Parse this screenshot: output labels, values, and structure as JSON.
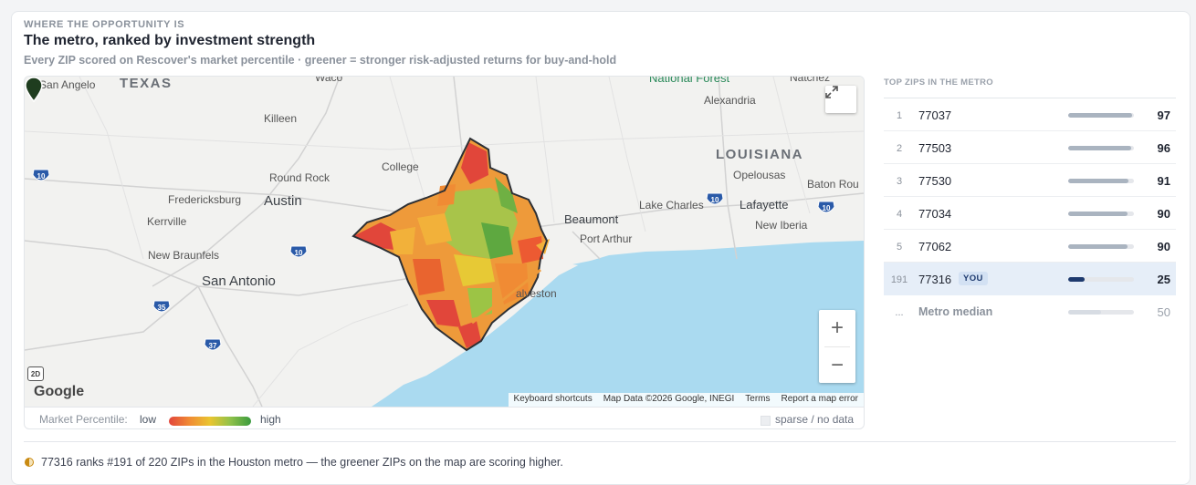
{
  "header": {
    "eyebrow": "WHERE THE OPPORTUNITY IS",
    "title": "The metro, ranked by investment strength",
    "subtitle": "Every ZIP scored on Rescover's market percentile · greener = stronger risk-adjusted returns for buy-and-hold"
  },
  "map": {
    "labels": {
      "san_angelo": "San Angelo",
      "texas": "TEXAS",
      "waco": "Waco",
      "national_forest": "National Forest",
      "natchez": "Natchez",
      "alexandria": "Alexandria",
      "killeen": "Killeen",
      "louisiana": "LOUISIANA",
      "college_station": "College",
      "opelousas": "Opelousas",
      "round_rock": "Round Rock",
      "baton_rouge": "Baton Rou",
      "fredericksburg": "Fredericksburg",
      "austin": "Austin",
      "lake_charles": "Lake Charles",
      "lafayette": "Lafayette",
      "kerrville": "Kerrville",
      "beaumont": "Beaumont",
      "new_iberia": "New Iberia",
      "port_arthur": "Port Arthur",
      "new_braunfels": "New Braunfels",
      "san_antonio": "San Antonio",
      "galveston": "alveston"
    },
    "highways": {
      "i10": "10",
      "i35": "35",
      "i37": "37"
    },
    "badge_2d": "2D",
    "google_logo": "Google",
    "attribution": {
      "shortcuts": "Keyboard shortcuts",
      "data": "Map Data ©2026 Google, INEGI",
      "terms": "Terms",
      "report": "Report a map error"
    },
    "zoom_in": "+",
    "zoom_out": "−",
    "fullscreen_icon": "expand-icon"
  },
  "legend": {
    "title": "Market Percentile:",
    "low": "low",
    "high": "high",
    "sparse": "sparse / no data",
    "colors": [
      "#e2453b",
      "#f08b34",
      "#e9c530",
      "#8fc14a",
      "#3a9a3e"
    ]
  },
  "sidebar": {
    "title": "TOP ZIPS IN THE METRO",
    "rows": [
      {
        "rank": "1",
        "zip": "77037",
        "score": 97
      },
      {
        "rank": "2",
        "zip": "77503",
        "score": 96
      },
      {
        "rank": "3",
        "zip": "77530",
        "score": 91
      },
      {
        "rank": "4",
        "zip": "77034",
        "score": 90
      },
      {
        "rank": "5",
        "zip": "77062",
        "score": 90
      }
    ],
    "you_row": {
      "rank": "191",
      "zip": "77316",
      "tag": "YOU",
      "score": 25
    },
    "median_row": {
      "rank": "...",
      "label": "Metro median",
      "score": 50
    },
    "colors": {
      "bar": "#aab4c0",
      "you_bar": "#1e3a6e",
      "median_bar": "#d7dce3"
    }
  },
  "footer": {
    "text": "77316 ranks #191 of 220 ZIPs in the Houston metro — the greener ZIPs on the map are scoring higher."
  }
}
